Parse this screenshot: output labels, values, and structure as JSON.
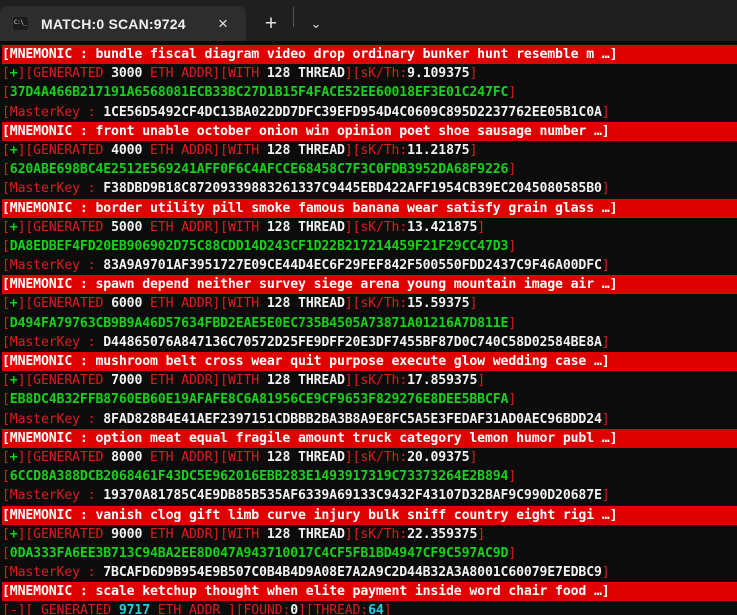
{
  "window": {
    "tab_title": "MATCH:0 SCAN:9724",
    "tab_icon": "console-icon",
    "close_label": "×",
    "new_tab_label": "+",
    "dropdown_label": "⌄"
  },
  "colors": {
    "background": "#0c0c0c",
    "titlebar": "#1f1f1f",
    "tab_active": "#2d2d2d",
    "mnemonic_bg": "#e00000",
    "red": "#e01b1b",
    "green": "#15d215",
    "white": "#f2f2f2",
    "cyan": "#1fd2e0"
  },
  "terminal": {
    "labels": {
      "mnemonic_prefix": "[MNEMONIC : ",
      "mnemonic_suffix": "]",
      "ellipsis": "…",
      "masterkey_prefix": "[MasterKey : ",
      "generated_open": "[+][GENERATED ",
      "eth_addr": " ETH ADDR][WITH ",
      "thread": " THREAD][",
      "skth": "sK/Th:",
      "bracket_close": "]",
      "bracket_open": "[",
      "final_prefix": "[-][ GENERATED ",
      "final_mid": " ETH ADDR ][FOUND:",
      "final_found_close": "][THREAD:",
      "final_close": "]"
    },
    "blocks": [
      {
        "mnemonic": "bundle fiscal diagram video drop ordinary bunker hunt resemble m",
        "generated": "3000",
        "threads": "128",
        "skth": "9.109375",
        "address": "37D4A466B217191A6568081ECB33BC27D1B15F4FACE52EE60018EF3E01C247FC",
        "masterkey": "1CE56D5492CF4DC13BA022DD7DFC39EFD954D4C0609C895D2237762EE05B1C0A"
      },
      {
        "mnemonic": "front unable october onion win opinion poet shoe sausage number",
        "generated": "4000",
        "threads": "128",
        "skth": "11.21875",
        "address": "620ABE698BC4E2512E569241AFF0F6C4AFCCE68458C7F3C0FDB3952DA68F9226",
        "masterkey": "F38DBD9B18C87209339883261337C9445EBD422AFF1954CB39EC2045080585B0"
      },
      {
        "mnemonic": "border utility pill smoke famous banana wear satisfy grain glass",
        "generated": "5000",
        "threads": "128",
        "skth": "13.421875",
        "address": "DA8EDBEF4FD20EB906902D75C88CDD14D243CF1D22B217214459F21F29CC47D3",
        "masterkey": "83A9A9701AF3951727E09CE44D4EC6F29FEF842F500550FDD2437C9F46A00DFC"
      },
      {
        "mnemonic": "spawn depend neither survey siege arena young mountain image air",
        "generated": "6000",
        "threads": "128",
        "skth": "15.59375",
        "address": "D494FA79763CB9B9A46D57634FBD2EAE5E0EC735B4505A73871A01216A7D811E",
        "masterkey": "D44865076A847136C70572D25FE9DFF20E3DF7455BF87D0C740C58D02584BE8A"
      },
      {
        "mnemonic": "mushroom belt cross wear quit purpose execute glow wedding case",
        "generated": "7000",
        "threads": "128",
        "skth": "17.859375",
        "address": "EB8DC4B32FFB8760EB60E19AFAFE8C6A81956CE9CF9653F829276E8DEE5BBCFA",
        "masterkey": "8FAD828B4E41AEF2397151CDBBB2BA3B8A9E8FC5A5E3FEDAF31AD0AEC96BDD24"
      },
      {
        "mnemonic": "option meat equal fragile amount truck category lemon humor publ",
        "generated": "8000",
        "threads": "128",
        "skth": "20.09375",
        "address": "6CCD8A388DCB2068461F43DC5E962016EBB283E1493917319C73373264E2B894",
        "masterkey": "19370A81785C4E9DB85B535AF6339A69133C9432F43107D32BAF9C990D20687E"
      },
      {
        "mnemonic": "vanish clog gift limb curve injury bulk sniff country eight rigi",
        "generated": "9000",
        "threads": "128",
        "skth": "22.359375",
        "address": "0DA333FA6EE3B713C94BA2EE8D047A943710017C4CF5FB1BD4947CF9C597AC9D",
        "masterkey": "7BCAFD6D9B954E9B507C0B4B4D9A08E7A2A9C2D44B32A3A8001C60079E7EDBC9"
      }
    ],
    "final_mnemonic": "scale ketchup thought when elite payment inside word chair food",
    "status": {
      "generated": "9717",
      "found": "0",
      "thread": "64"
    }
  }
}
